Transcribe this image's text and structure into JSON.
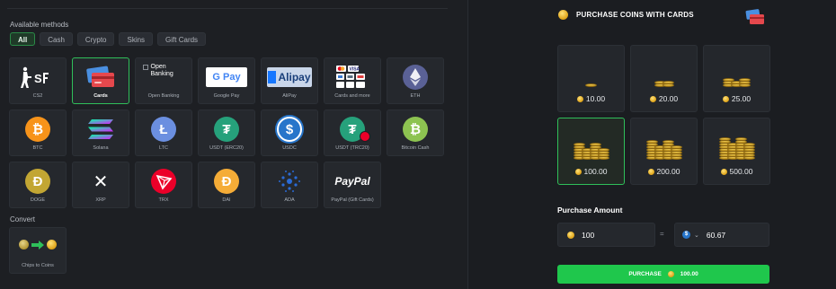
{
  "methods": {
    "title": "Available methods",
    "filters": [
      "All",
      "Cash",
      "Crypto",
      "Skins",
      "Gift Cards"
    ],
    "active_filter": "All",
    "items": [
      {
        "label": "CS2",
        "icon": "cs2-logo-icon"
      },
      {
        "label": "Cards",
        "icon": "credit-cards-icon",
        "selected": true
      },
      {
        "label": "Open Banking",
        "icon": "open-banking-broken-image-icon",
        "icon_text": "Open Banking"
      },
      {
        "label": "Google Pay",
        "icon": "google-pay-icon",
        "icon_text": "G Pay"
      },
      {
        "label": "AliPay",
        "icon": "alipay-icon",
        "icon_text": "Alipay"
      },
      {
        "label": "Cards and more",
        "icon": "card-brands-icon"
      },
      {
        "label": "ETH",
        "icon": "ethereum-icon"
      },
      {
        "label": "BTC",
        "icon": "bitcoin-icon",
        "icon_text": "₿"
      },
      {
        "label": "Solana",
        "icon": "solana-icon"
      },
      {
        "label": "LTC",
        "icon": "litecoin-icon",
        "icon_text": "Ł"
      },
      {
        "label": "USDT (ERC20)",
        "icon": "tether-icon",
        "icon_text": "₮"
      },
      {
        "label": "USDC",
        "icon": "usdc-icon",
        "icon_text": "$"
      },
      {
        "label": "USDT (TRC20)",
        "icon": "tether-tron-icon",
        "icon_text": "₮"
      },
      {
        "label": "Bitcoin Cash",
        "icon": "bitcoin-cash-icon",
        "icon_text": "₿"
      },
      {
        "label": "DOGE",
        "icon": "dogecoin-icon",
        "icon_text": "Ð"
      },
      {
        "label": "XRP",
        "icon": "xrp-icon",
        "icon_text": "✕"
      },
      {
        "label": "TRX",
        "icon": "tron-icon"
      },
      {
        "label": "DAI",
        "icon": "dai-icon",
        "icon_text": "Đ"
      },
      {
        "label": "ADA",
        "icon": "cardano-icon"
      },
      {
        "label": "PayPal (Gift Cards)",
        "icon": "paypal-icon",
        "icon_text": "PayPal"
      }
    ]
  },
  "convert": {
    "title": "Convert",
    "tile_label": "Chips to Coins",
    "icon": "chips-to-coins-icon"
  },
  "purchase": {
    "title": "PURCHASE COINS WITH CARDS",
    "header_icon": "credit-cards-icon",
    "packs": [
      {
        "amount": "10.00",
        "coins": 1
      },
      {
        "amount": "20.00",
        "coins": 2
      },
      {
        "amount": "25.00",
        "coins": 3
      },
      {
        "amount": "100.00",
        "coins": 5,
        "selected": true
      },
      {
        "amount": "200.00",
        "coins": 6
      },
      {
        "amount": "500.00",
        "coins": 7
      }
    ],
    "amount_label": "Purchase Amount",
    "coin_amount": "100",
    "equals": "=",
    "currency_amount": "60.67",
    "currency_icon": "usdc-icon",
    "button_label": "PURCHASE",
    "button_amount": "100.00"
  },
  "colors": {
    "accent_green": "#1fc74c",
    "selected_border": "#2fbf5a",
    "coin_gold": "#e0a61c"
  }
}
